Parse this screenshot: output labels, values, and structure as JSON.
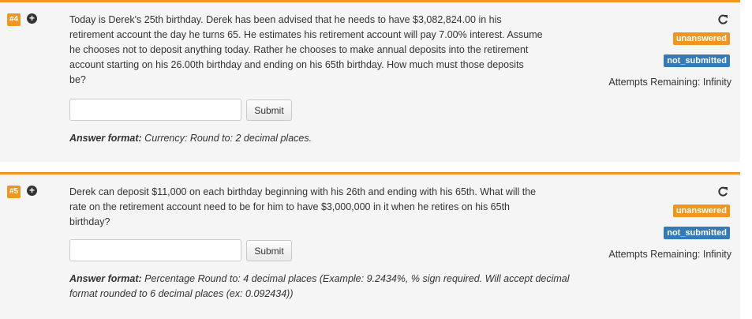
{
  "problems": [
    {
      "number": "#4",
      "question": "Today is Derek's 25th birthday. Derek has been advised that he needs to have $3,082,824.00 in his retirement account the day he turns 65. He estimates his retirement account will pay 7.00% interest. Assume he chooses not to deposit anything today. Rather he chooses to make annual deposits into the retirement account starting on his 26.00th birthday and ending on his 65th birthday. How much must those deposits be?",
      "answer_value": "",
      "submit_label": "Submit",
      "format_label": "Answer format:",
      "format_text": "Currency: Round to: 2 decimal places.",
      "status": "unanswered",
      "submission": "not_submitted",
      "attempts": "Attempts Remaining: Infinity"
    },
    {
      "number": "#5",
      "question": "Derek can deposit $11,000 on each birthday beginning with his 26th and ending with his 65th. What will the rate on the retirement account need to be for him to have $3,000,000 in it when he retires on his 65th birthday?",
      "answer_value": "",
      "submit_label": "Submit",
      "format_label": "Answer format:",
      "format_text": "Percentage Round to: 4 decimal places (Example: 9.2434%, % sign required. Will accept decimal format rounded to 6 decimal places (ex: 0.092434))",
      "status": "unanswered",
      "submission": "not_submitted",
      "attempts": "Attempts Remaining: Infinity"
    }
  ],
  "colors": {
    "accent_orange": "#f0961e",
    "status_blue": "#337ab7",
    "panel_bg": "#f5f5f5"
  },
  "icons": {
    "expand": "plus-circle-icon",
    "share": "share-icon"
  }
}
